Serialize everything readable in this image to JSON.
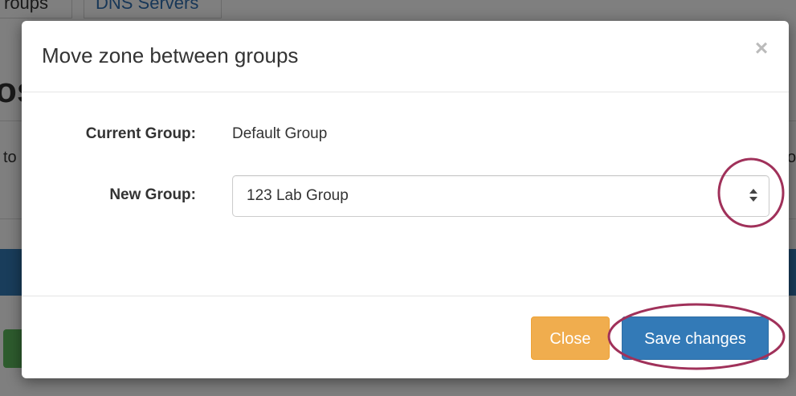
{
  "background": {
    "tabs": [
      "roups",
      "DNS Servers"
    ],
    "heading_fragment": "os",
    "text_left_fragment": "to",
    "text_right_fragment": "o"
  },
  "modal": {
    "title": "Move zone between groups",
    "close_icon": "×",
    "current_group": {
      "label": "Current Group:",
      "value": "Default Group"
    },
    "new_group": {
      "label": "New Group:",
      "selected": "123 Lab Group"
    },
    "buttons": {
      "close": "Close",
      "save": "Save changes"
    }
  },
  "colors": {
    "primary": "#337ab7",
    "warning": "#f0ad4e",
    "annotation": "#a0315a"
  },
  "icons": {
    "select_arrows": "updown-arrows-icon",
    "dismiss": "close-icon"
  }
}
